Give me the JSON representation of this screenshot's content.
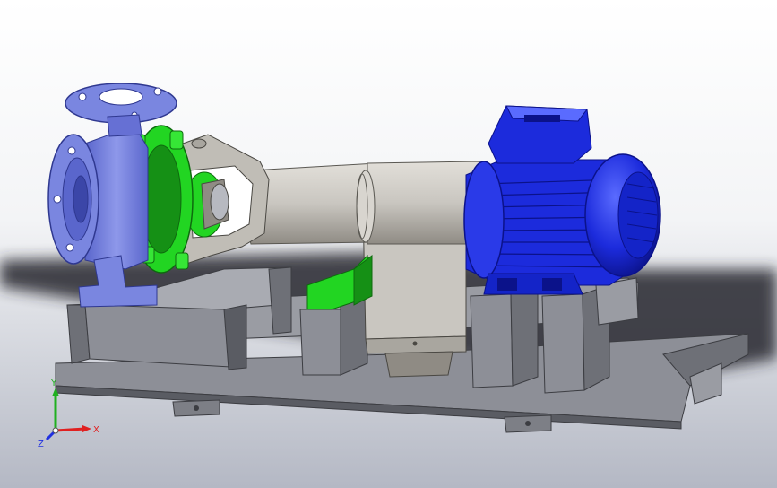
{
  "viewport": {
    "background_top": "#ffffff",
    "background_bottom": "#b4b8c4",
    "shadow_color": "#26282e"
  },
  "model": {
    "colors": {
      "casing": "#7a86e0",
      "casing_dark": "#4e59c0",
      "bracket": "#22d522",
      "bracket_dark": "#159015",
      "steel_frame": "#8d8f97",
      "steel_dark": "#5a5c63",
      "steel_light": "#b7b9c0",
      "bearing_frame": "#c9c6c0",
      "bearing_dark": "#8f8b84",
      "motor": "#1c2bdc",
      "motor_dark": "#0b128a",
      "motor_light": "#5a6bff",
      "shaft": "#eae8e4"
    },
    "icons": [
      "pump-casing-flange",
      "lantern-bracket",
      "bearing-housing",
      "motor",
      "baseplate"
    ]
  },
  "triad": {
    "x_label": "X",
    "y_label": "Y",
    "z_label": "Z",
    "x_color": "#e02020",
    "y_color": "#20b020",
    "z_color": "#2030e0"
  }
}
